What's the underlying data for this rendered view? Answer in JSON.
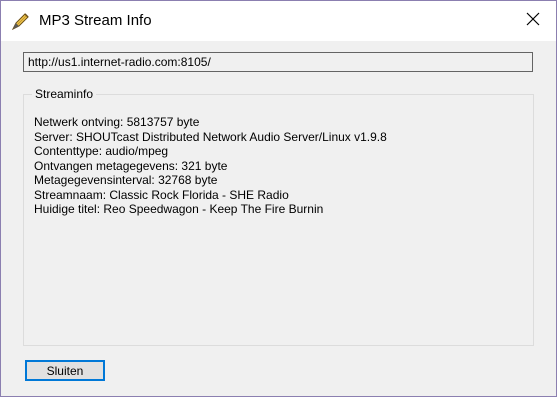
{
  "window": {
    "title": "MP3 Stream Info",
    "title_icon": "pencil-feather-icon",
    "close_icon": "close-icon"
  },
  "url": {
    "value": "http://us1.internet-radio.com:8105/"
  },
  "streaminfo": {
    "legend": "Streaminfo",
    "lines": [
      "Netwerk ontving: 5813757 byte",
      "Server: SHOUTcast Distributed Network Audio Server/Linux v1.9.8",
      "Contenttype: audio/mpeg",
      "Ontvangen metagegevens: 321 byte",
      "Metagegevensinterval: 32768 byte",
      "Streamnaam: Classic Rock Florida - SHE Radio",
      "Huidige titel: Reo Speedwagon - Keep The Fire Burnin"
    ]
  },
  "buttons": {
    "close_label": "Sluiten"
  },
  "colors": {
    "window_border": "#8b7fb0",
    "background": "#f0f0f0",
    "button_focus": "#0078d7"
  }
}
